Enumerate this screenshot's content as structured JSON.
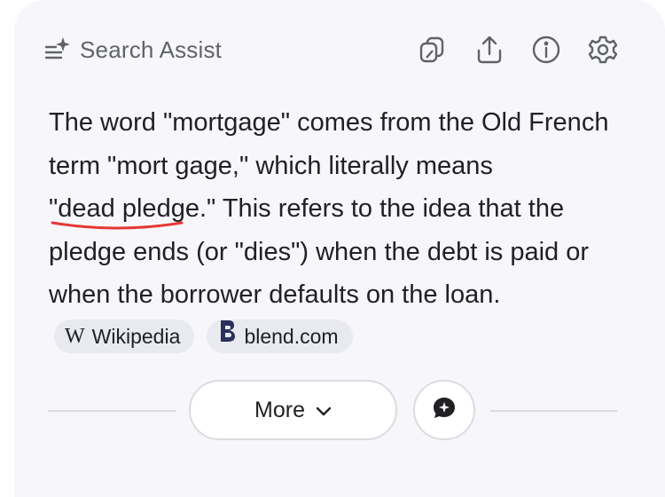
{
  "header": {
    "title": "Search Assist",
    "icons": [
      "sparkle-list-icon",
      "copy-icon",
      "share-icon",
      "info-icon",
      "settings-icon"
    ]
  },
  "answer": {
    "part1": "The word \"mortgage\" comes from the Old French term \"mort gage,\" which literally means ",
    "highlight": "\"dead pledge.\"",
    "part2": " This refers to the idea that the pledge ends (or \"dies\") when the debt is paid or when the borrower defaults on the loan."
  },
  "sources": [
    {
      "logo": "W",
      "label": "Wikipedia"
    },
    {
      "logo": "blend-icon",
      "label": "blend.com"
    }
  ],
  "footer": {
    "more_label": "More"
  },
  "colors": {
    "underline": "#e53935",
    "card_bg": "#f7f7fb",
    "chip_bg": "#e8eaf0"
  }
}
